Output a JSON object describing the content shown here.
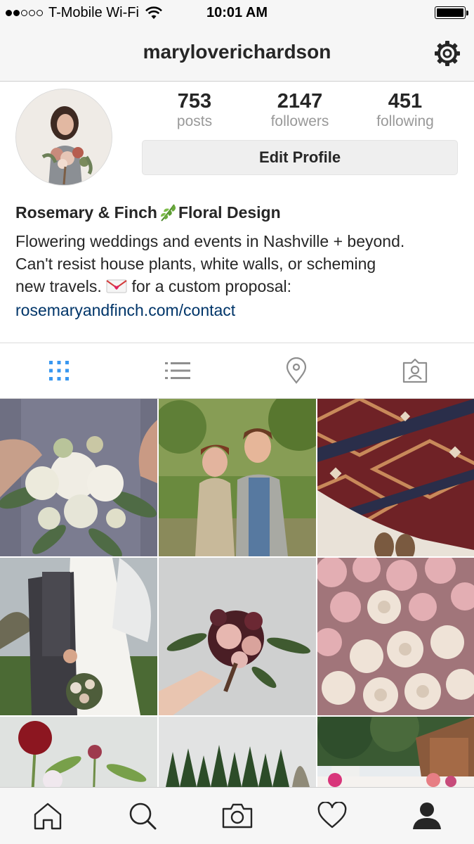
{
  "status_bar": {
    "carrier": "T-Mobile Wi-Fi",
    "time": "10:01 AM",
    "signal_bars_filled": 2,
    "signal_bars_total": 5,
    "battery_level": 1.0
  },
  "header": {
    "username": "maryloverichardson",
    "settings_icon": "gear-icon"
  },
  "profile": {
    "stats": [
      {
        "value": "753",
        "label": "posts"
      },
      {
        "value": "2147",
        "label": "followers"
      },
      {
        "value": "451",
        "label": "following"
      }
    ],
    "edit_button_label": "Edit Profile",
    "name_part1": "Rosemary & Finch",
    "name_emoji_icon": "herb-leaf-icon",
    "name_part2": "Floral Design",
    "bio_line1": "Flowering weddings and events in Nashville + beyond.",
    "bio_line2": "Can't resist house plants, white walls, or scheming",
    "bio_line3a": "new travels. ",
    "bio_line3_emoji_icon": "love-letter-icon",
    "bio_line3b": " for a custom proposal:",
    "website": "rosemaryandfinch.com/contact"
  },
  "view_tabs": [
    {
      "icon": "grid-icon",
      "active": true
    },
    {
      "icon": "list-icon",
      "active": false
    },
    {
      "icon": "location-pin-icon",
      "active": false
    },
    {
      "icon": "tagged-photos-icon",
      "active": false
    }
  ],
  "photos": [
    {
      "name": "bridal-bouquet-white"
    },
    {
      "name": "couple-portrait"
    },
    {
      "name": "persian-rug"
    },
    {
      "name": "bride-groom-embrace"
    },
    {
      "name": "burgundy-bouquet"
    },
    {
      "name": "pink-white-roses"
    },
    {
      "name": "red-ranunculus"
    },
    {
      "name": "evergreen-trees"
    },
    {
      "name": "outdoor-reception"
    }
  ],
  "bottom_tabs": [
    {
      "icon": "home-icon",
      "active": false
    },
    {
      "icon": "search-icon",
      "active": false
    },
    {
      "icon": "camera-icon",
      "active": false
    },
    {
      "icon": "heart-icon",
      "active": false
    },
    {
      "icon": "profile-icon",
      "active": true
    }
  ],
  "colors": {
    "accent_blue": "#3897f0",
    "link_blue": "#003569",
    "text_dark": "#262626",
    "text_muted": "#999999",
    "bar_bg": "#f6f6f6"
  }
}
